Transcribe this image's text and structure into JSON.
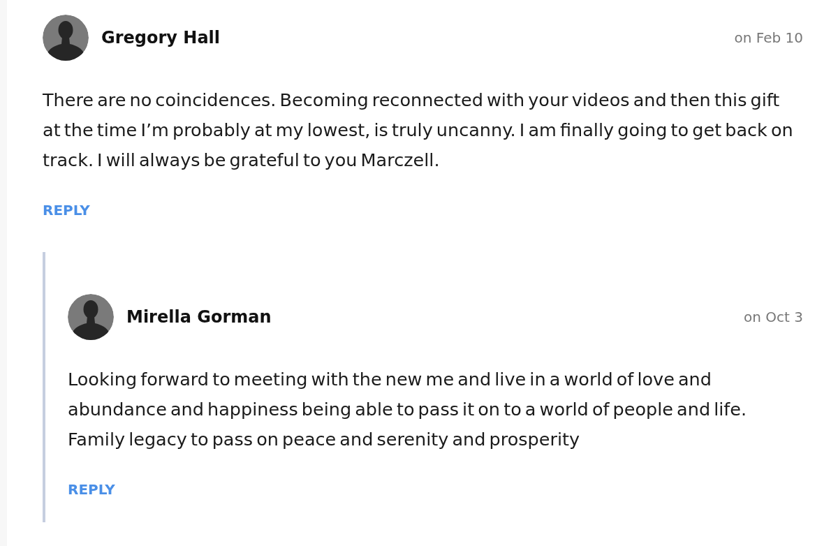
{
  "comments": [
    {
      "author": "Gregory Hall",
      "date": "on Feb 10",
      "body": "There are no coincidences. Becoming reconnected with your videos and then this gift at the time I’m probably at my lowest, is truly uncanny. I am finally going to get back on track. I will always be grateful to you Marczell.",
      "reply_label": "REPLY",
      "children": [
        {
          "author": "Mirella Gorman",
          "date": "on Oct 3",
          "body": "Looking forward to meeting with the new me and live in a world of love and abundance and happiness being able to pass it on to a world of people and life. Family legacy to pass on peace and serenity and prosperity",
          "reply_label": "REPLY"
        }
      ]
    }
  ]
}
